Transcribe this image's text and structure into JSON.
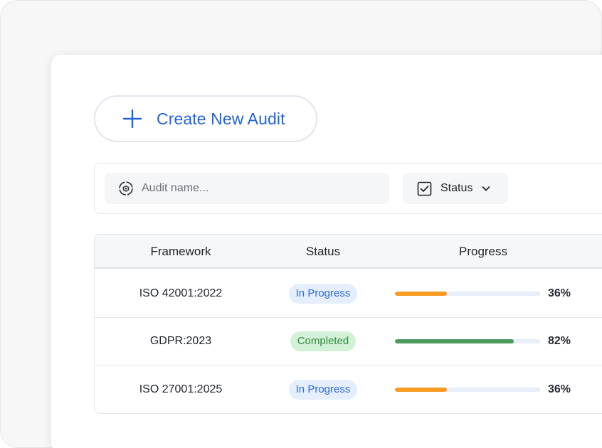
{
  "toolbar": {
    "create_label": "Create New Audit",
    "accent_color": "#2363de"
  },
  "filters": {
    "search_placeholder": "Audit name...",
    "status_label": "Status"
  },
  "table": {
    "columns": [
      "Framework",
      "Status",
      "Progress"
    ],
    "rows": [
      {
        "framework": "ISO 42001:2022",
        "status": "In Progress",
        "status_kind": "in-progress",
        "progress": 36,
        "progress_label": "36%",
        "bar_color": "#f89b22"
      },
      {
        "framework": "GDPR:2023",
        "status": "Completed",
        "status_kind": "completed",
        "progress": 82,
        "progress_label": "82%",
        "bar_color": "#4b9a5e"
      },
      {
        "framework": "ISO 27001:2025",
        "status": "In Progress",
        "status_kind": "in-progress",
        "progress": 36,
        "progress_label": "36%",
        "bar_color": "#f89b22"
      }
    ]
  },
  "icons": {
    "create": "plus-icon",
    "search": "search-target-icon",
    "status": "checkbox-icon",
    "dropdown": "chevron-down-icon"
  }
}
